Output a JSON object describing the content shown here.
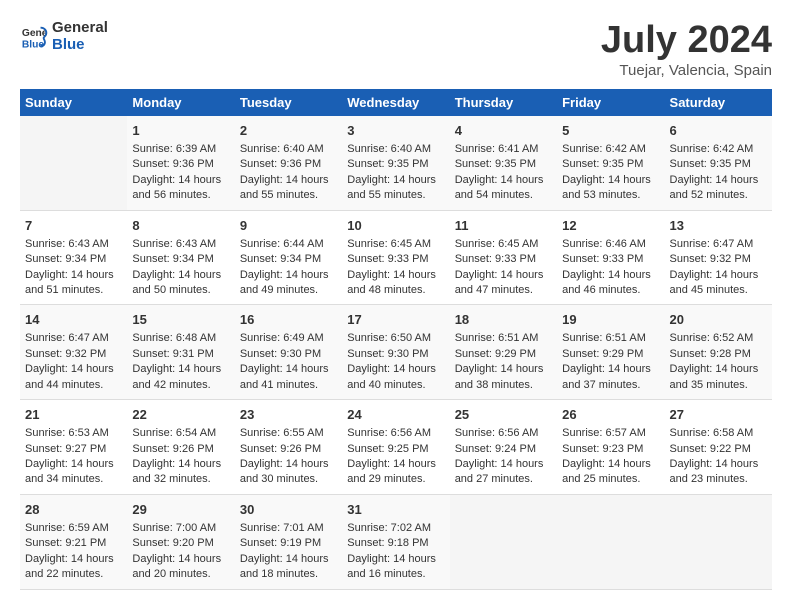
{
  "header": {
    "logo_line1": "General",
    "logo_line2": "Blue",
    "title": "July 2024",
    "subtitle": "Tuejar, Valencia, Spain"
  },
  "days_of_week": [
    "Sunday",
    "Monday",
    "Tuesday",
    "Wednesday",
    "Thursday",
    "Friday",
    "Saturday"
  ],
  "weeks": [
    [
      {
        "day": "",
        "data": ""
      },
      {
        "day": "1",
        "data": "Sunrise: 6:39 AM\nSunset: 9:36 PM\nDaylight: 14 hours\nand 56 minutes."
      },
      {
        "day": "2",
        "data": "Sunrise: 6:40 AM\nSunset: 9:36 PM\nDaylight: 14 hours\nand 55 minutes."
      },
      {
        "day": "3",
        "data": "Sunrise: 6:40 AM\nSunset: 9:35 PM\nDaylight: 14 hours\nand 55 minutes."
      },
      {
        "day": "4",
        "data": "Sunrise: 6:41 AM\nSunset: 9:35 PM\nDaylight: 14 hours\nand 54 minutes."
      },
      {
        "day": "5",
        "data": "Sunrise: 6:42 AM\nSunset: 9:35 PM\nDaylight: 14 hours\nand 53 minutes."
      },
      {
        "day": "6",
        "data": "Sunrise: 6:42 AM\nSunset: 9:35 PM\nDaylight: 14 hours\nand 52 minutes."
      }
    ],
    [
      {
        "day": "7",
        "data": "Sunrise: 6:43 AM\nSunset: 9:34 PM\nDaylight: 14 hours\nand 51 minutes."
      },
      {
        "day": "8",
        "data": "Sunrise: 6:43 AM\nSunset: 9:34 PM\nDaylight: 14 hours\nand 50 minutes."
      },
      {
        "day": "9",
        "data": "Sunrise: 6:44 AM\nSunset: 9:34 PM\nDaylight: 14 hours\nand 49 minutes."
      },
      {
        "day": "10",
        "data": "Sunrise: 6:45 AM\nSunset: 9:33 PM\nDaylight: 14 hours\nand 48 minutes."
      },
      {
        "day": "11",
        "data": "Sunrise: 6:45 AM\nSunset: 9:33 PM\nDaylight: 14 hours\nand 47 minutes."
      },
      {
        "day": "12",
        "data": "Sunrise: 6:46 AM\nSunset: 9:33 PM\nDaylight: 14 hours\nand 46 minutes."
      },
      {
        "day": "13",
        "data": "Sunrise: 6:47 AM\nSunset: 9:32 PM\nDaylight: 14 hours\nand 45 minutes."
      }
    ],
    [
      {
        "day": "14",
        "data": "Sunrise: 6:47 AM\nSunset: 9:32 PM\nDaylight: 14 hours\nand 44 minutes."
      },
      {
        "day": "15",
        "data": "Sunrise: 6:48 AM\nSunset: 9:31 PM\nDaylight: 14 hours\nand 42 minutes."
      },
      {
        "day": "16",
        "data": "Sunrise: 6:49 AM\nSunset: 9:30 PM\nDaylight: 14 hours\nand 41 minutes."
      },
      {
        "day": "17",
        "data": "Sunrise: 6:50 AM\nSunset: 9:30 PM\nDaylight: 14 hours\nand 40 minutes."
      },
      {
        "day": "18",
        "data": "Sunrise: 6:51 AM\nSunset: 9:29 PM\nDaylight: 14 hours\nand 38 minutes."
      },
      {
        "day": "19",
        "data": "Sunrise: 6:51 AM\nSunset: 9:29 PM\nDaylight: 14 hours\nand 37 minutes."
      },
      {
        "day": "20",
        "data": "Sunrise: 6:52 AM\nSunset: 9:28 PM\nDaylight: 14 hours\nand 35 minutes."
      }
    ],
    [
      {
        "day": "21",
        "data": "Sunrise: 6:53 AM\nSunset: 9:27 PM\nDaylight: 14 hours\nand 34 minutes."
      },
      {
        "day": "22",
        "data": "Sunrise: 6:54 AM\nSunset: 9:26 PM\nDaylight: 14 hours\nand 32 minutes."
      },
      {
        "day": "23",
        "data": "Sunrise: 6:55 AM\nSunset: 9:26 PM\nDaylight: 14 hours\nand 30 minutes."
      },
      {
        "day": "24",
        "data": "Sunrise: 6:56 AM\nSunset: 9:25 PM\nDaylight: 14 hours\nand 29 minutes."
      },
      {
        "day": "25",
        "data": "Sunrise: 6:56 AM\nSunset: 9:24 PM\nDaylight: 14 hours\nand 27 minutes."
      },
      {
        "day": "26",
        "data": "Sunrise: 6:57 AM\nSunset: 9:23 PM\nDaylight: 14 hours\nand 25 minutes."
      },
      {
        "day": "27",
        "data": "Sunrise: 6:58 AM\nSunset: 9:22 PM\nDaylight: 14 hours\nand 23 minutes."
      }
    ],
    [
      {
        "day": "28",
        "data": "Sunrise: 6:59 AM\nSunset: 9:21 PM\nDaylight: 14 hours\nand 22 minutes."
      },
      {
        "day": "29",
        "data": "Sunrise: 7:00 AM\nSunset: 9:20 PM\nDaylight: 14 hours\nand 20 minutes."
      },
      {
        "day": "30",
        "data": "Sunrise: 7:01 AM\nSunset: 9:19 PM\nDaylight: 14 hours\nand 18 minutes."
      },
      {
        "day": "31",
        "data": "Sunrise: 7:02 AM\nSunset: 9:18 PM\nDaylight: 14 hours\nand 16 minutes."
      },
      {
        "day": "",
        "data": ""
      },
      {
        "day": "",
        "data": ""
      },
      {
        "day": "",
        "data": ""
      }
    ]
  ]
}
